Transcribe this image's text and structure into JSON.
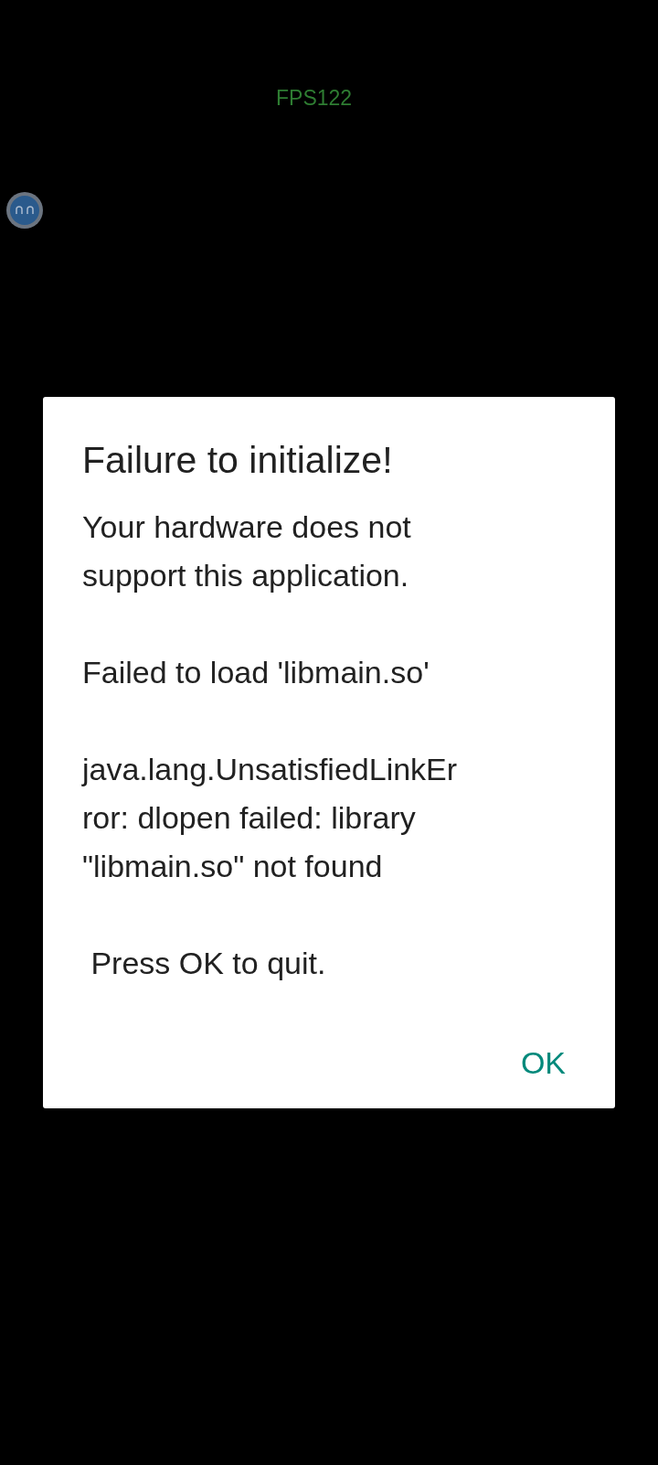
{
  "overlay": {
    "fps": "FPS122"
  },
  "dialog": {
    "title": "Failure to initialize!",
    "paragraphs": [
      {
        "lines": [
          "Your hardware does not",
          "support this application."
        ]
      },
      {
        "lines": [
          "Failed to load 'libmain.so'"
        ]
      },
      {
        "lines": [
          "java.lang.UnsatisfiedLinkEr",
          "ror: dlopen failed: library",
          "\"libmain.so\" not found"
        ]
      },
      {
        "lines": [
          " Press OK to quit."
        ]
      }
    ],
    "buttons": [
      "OK"
    ]
  }
}
